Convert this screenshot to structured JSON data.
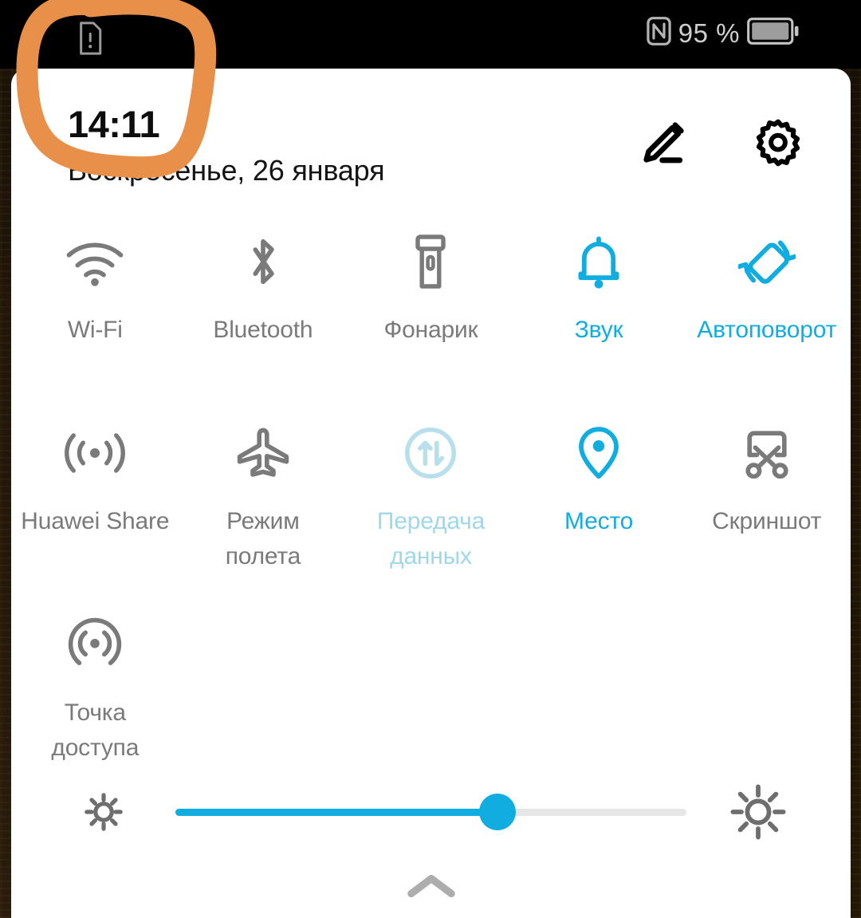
{
  "statusbar": {
    "sim_icon": "sim-card-alert-icon",
    "nfc_icon": "nfc-icon",
    "battery_percent": "95 %",
    "battery_icon": "battery-full-icon"
  },
  "header": {
    "time": "14:11",
    "date": "Воскресенье, 26 января",
    "edit_icon": "pencil-edit-icon",
    "settings_icon": "gear-icon"
  },
  "toggles": [
    {
      "id": "wifi",
      "label": "Wi-Fi",
      "icon": "wifi-icon",
      "state": "off"
    },
    {
      "id": "bluetooth",
      "label": "Bluetooth",
      "icon": "bluetooth-icon",
      "state": "off"
    },
    {
      "id": "flashlight",
      "label": "Фонарик",
      "icon": "flashlight-icon",
      "state": "off"
    },
    {
      "id": "sound",
      "label": "Звук",
      "icon": "bell-icon",
      "state": "on"
    },
    {
      "id": "autorotate",
      "label": "Автоповорот",
      "icon": "auto-rotate-icon",
      "state": "on"
    },
    {
      "id": "huawei-share",
      "label": "Huawei Share",
      "icon": "huawei-share-icon",
      "state": "off"
    },
    {
      "id": "airplane",
      "label": "Режим полета",
      "icon": "airplane-icon",
      "state": "off"
    },
    {
      "id": "mobile-data",
      "label": "Передача данных",
      "icon": "data-transfer-icon",
      "state": "dim"
    },
    {
      "id": "location",
      "label": "Место",
      "icon": "location-pin-icon",
      "state": "on"
    },
    {
      "id": "screenshot",
      "label": "Скриншот",
      "icon": "scissors-icon",
      "state": "off"
    },
    {
      "id": "hotspot",
      "label": "Точка доступа",
      "icon": "hotspot-icon",
      "state": "off"
    }
  ],
  "brightness": {
    "low_icon": "brightness-low-icon",
    "high_icon": "brightness-high-icon",
    "value_percent": 63
  },
  "footer": {
    "collapse_icon": "chevron-up-icon"
  },
  "annotation": {
    "shape": "hand-drawn-orange-loop",
    "color": "#E8904A"
  },
  "colors": {
    "accent_blue": "#12ADE0",
    "dim_blue": "#B8E0EC",
    "inactive_grey": "#7A7A7A",
    "panel_bg": "#FFFFFF",
    "statusbar_bg": "#000000",
    "annotation_orange": "#E8904A"
  }
}
